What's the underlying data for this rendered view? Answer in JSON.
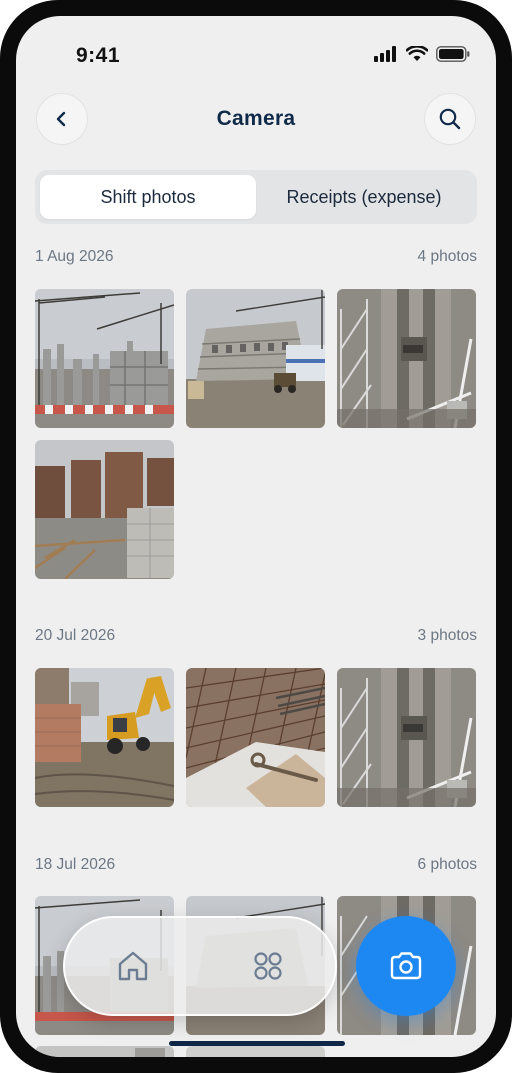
{
  "status": {
    "time": "9:41"
  },
  "header": {
    "title": "Camera",
    "back_icon": "chevron-left-icon",
    "search_icon": "search-icon"
  },
  "tabs": [
    {
      "label": "Shift photos",
      "active": true
    },
    {
      "label": "Receipts (expense)",
      "active": false
    }
  ],
  "groups": [
    {
      "date": "1 Aug 2026",
      "count": "4 photos",
      "photos": [
        "crane-site",
        "building-site",
        "shaft-stairs",
        "formwork"
      ]
    },
    {
      "date": "20 Jul 2026",
      "count": "3 photos",
      "photos": [
        "excavator",
        "rebar",
        "shaft-stairs"
      ]
    },
    {
      "date": "18 Jul 2026",
      "count": "6 photos",
      "photos": [
        "crane-site",
        "building-site",
        "shaft-stairs"
      ]
    }
  ],
  "nav": {
    "home_icon": "home-icon",
    "apps_icon": "grid-icon",
    "camera_icon": "camera-icon"
  },
  "colors": {
    "accent": "#1e88f2",
    "title": "#102a4a",
    "background": "#efefef"
  }
}
